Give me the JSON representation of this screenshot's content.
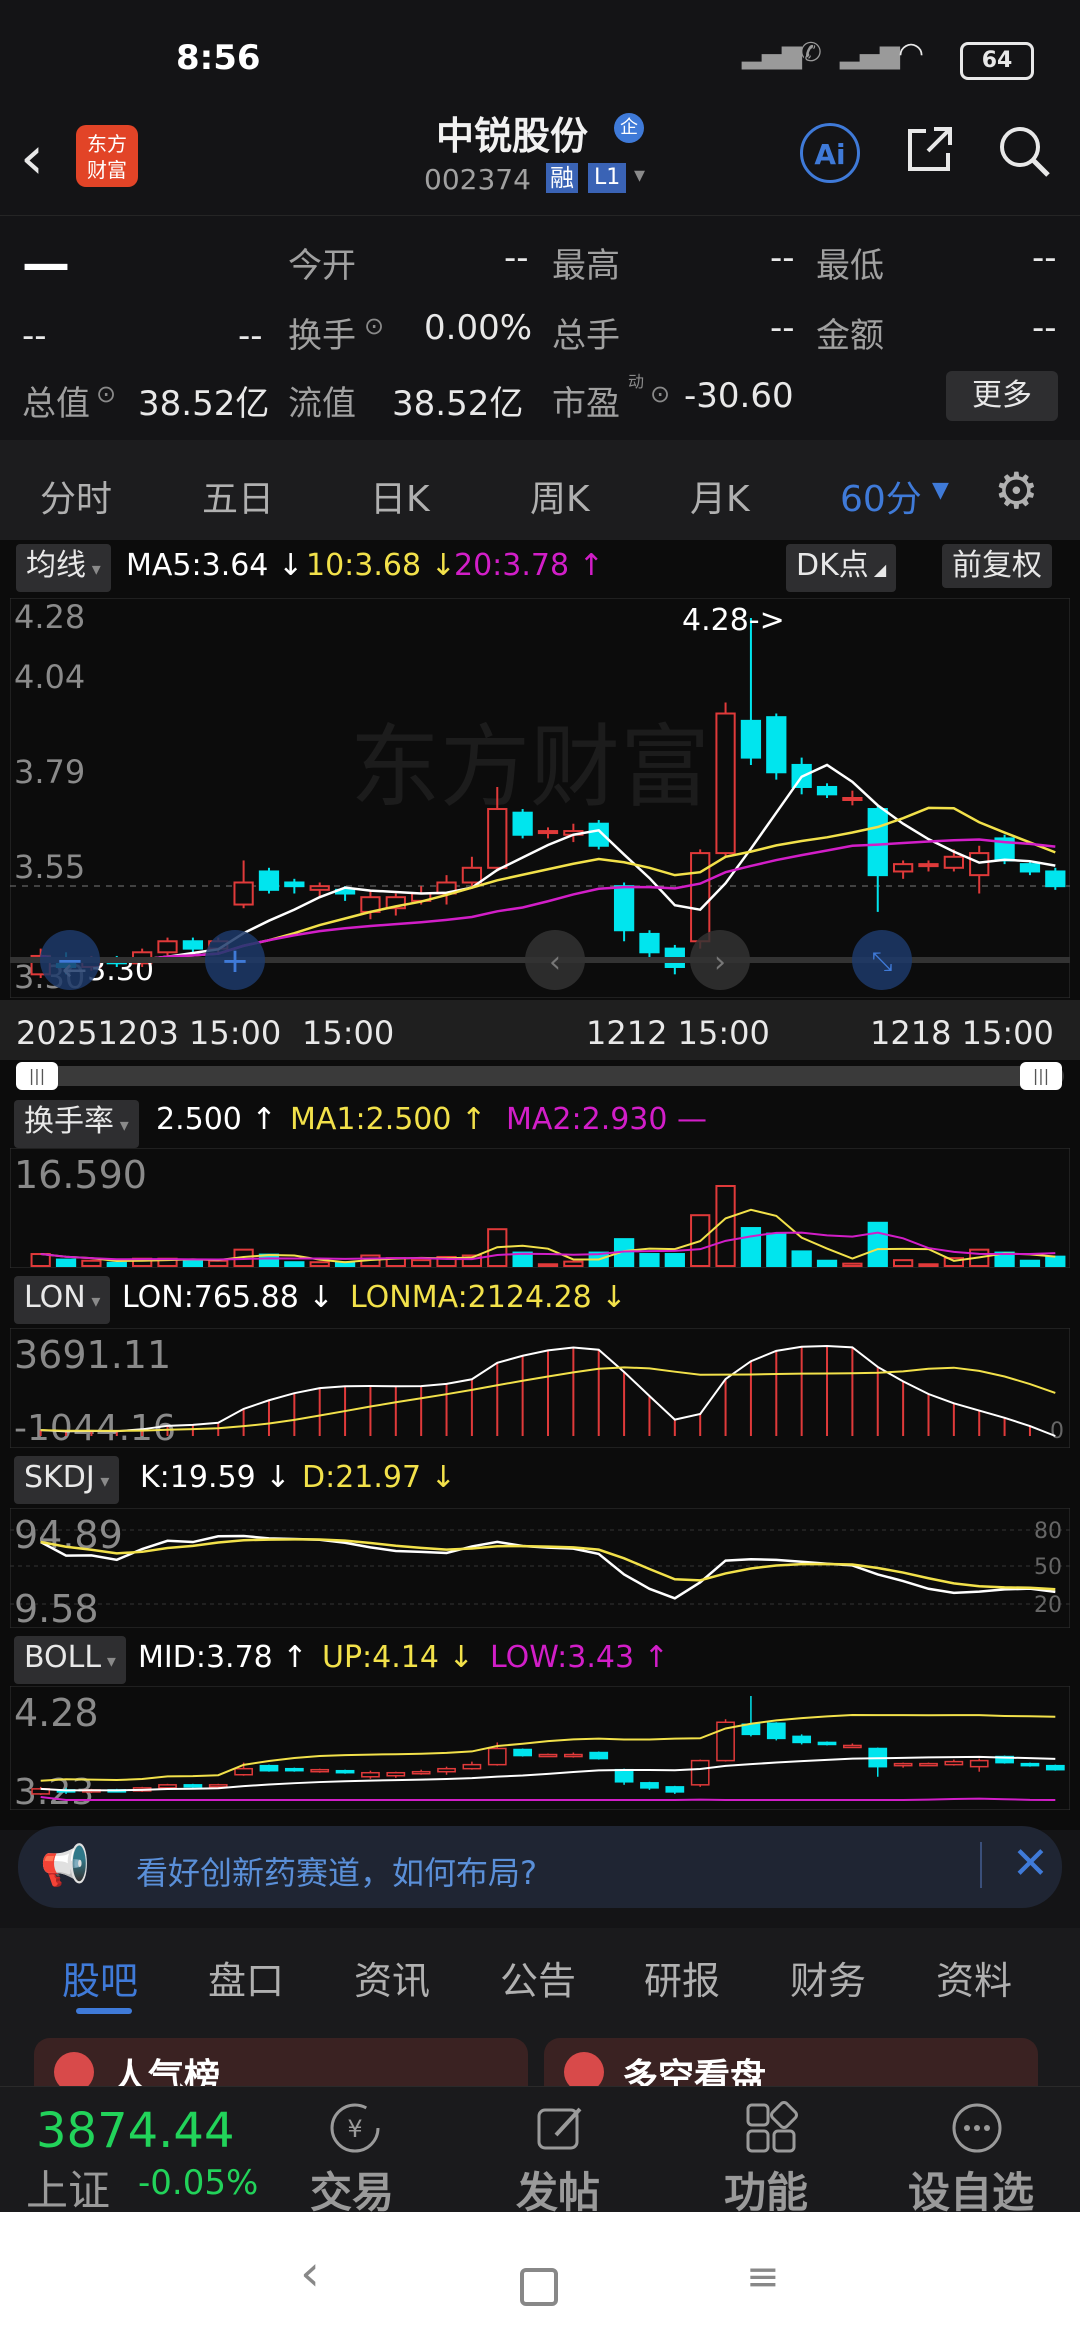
{
  "status_bar": {
    "time": "8:56",
    "battery": "64"
  },
  "header": {
    "stock_name": "中锐股份",
    "qi_badge": "企",
    "code": "002374",
    "rong": "融",
    "level": "L1",
    "ai_label": "Ai"
  },
  "quote": {
    "price": "—",
    "change": "--",
    "change_pct": "--",
    "jinkai_label": "今开",
    "jinkai": "--",
    "zuigao_label": "最高",
    "zuigao": "--",
    "zuidi_label": "最低",
    "zuidi": "--",
    "huanshou_label": "换手",
    "huanshou": "0.00%",
    "zongshou_label": "总手",
    "zongshou": "--",
    "jine_label": "金额",
    "jine": "--",
    "zongzhi_label": "总值",
    "zongzhi": "38.52亿",
    "liuzhi_label": "流值",
    "liuzhi": "38.52亿",
    "shiying_label": "市盈",
    "shiying_sup": "动",
    "shiying": "-30.60",
    "more": "更多"
  },
  "tabs": [
    "分时",
    "五日",
    "日K",
    "周K",
    "月K",
    "60分"
  ],
  "main_chart": {
    "indicator": "均线",
    "ma5": "MA5:3.64",
    "ma10": "10:3.68",
    "ma20": "20:3.78",
    "dk_label": "DK点",
    "fq_label": "前复权",
    "y_labels": [
      "4.28",
      "4.04",
      "3.79",
      "3.55",
      "3.30"
    ],
    "high_mark": "4.28->",
    "low_mark": "3.30",
    "x_labels": [
      "20251203 15:00",
      "15:00",
      "1212 15:00",
      "1218 15:00"
    ],
    "watermark": "东方财富"
  },
  "chart_data": {
    "type": "candlestick",
    "ylim": [
      3.3,
      4.28
    ],
    "candles": [
      {
        "o": 3.31,
        "c": 3.36,
        "h": 3.38,
        "l": 3.3
      },
      {
        "o": 3.35,
        "c": 3.33,
        "h": 3.37,
        "l": 3.31
      },
      {
        "o": 3.33,
        "c": 3.35,
        "h": 3.36,
        "l": 3.32
      },
      {
        "o": 3.35,
        "c": 3.34,
        "h": 3.36,
        "l": 3.33
      },
      {
        "o": 3.34,
        "c": 3.37,
        "h": 3.38,
        "l": 3.33
      },
      {
        "o": 3.37,
        "c": 3.4,
        "h": 3.41,
        "l": 3.36
      },
      {
        "o": 3.4,
        "c": 3.38,
        "h": 3.41,
        "l": 3.37
      },
      {
        "o": 3.38,
        "c": 3.4,
        "h": 3.41,
        "l": 3.37
      },
      {
        "o": 3.5,
        "c": 3.56,
        "h": 3.62,
        "l": 3.49
      },
      {
        "o": 3.59,
        "c": 3.54,
        "h": 3.6,
        "l": 3.53
      },
      {
        "o": 3.56,
        "c": 3.55,
        "h": 3.57,
        "l": 3.53
      },
      {
        "o": 3.54,
        "c": 3.55,
        "h": 3.56,
        "l": 3.52
      },
      {
        "o": 3.54,
        "c": 3.53,
        "h": 3.55,
        "l": 3.51
      },
      {
        "o": 3.48,
        "c": 3.52,
        "h": 3.54,
        "l": 3.46
      },
      {
        "o": 3.49,
        "c": 3.52,
        "h": 3.53,
        "l": 3.47
      },
      {
        "o": 3.51,
        "c": 3.53,
        "h": 3.55,
        "l": 3.5
      },
      {
        "o": 3.53,
        "c": 3.56,
        "h": 3.58,
        "l": 3.5
      },
      {
        "o": 3.56,
        "c": 3.6,
        "h": 3.63,
        "l": 3.55
      },
      {
        "o": 3.6,
        "c": 3.76,
        "h": 3.82,
        "l": 3.59
      },
      {
        "o": 3.75,
        "c": 3.69,
        "h": 3.76,
        "l": 3.68
      },
      {
        "o": 3.7,
        "c": 3.7,
        "h": 3.71,
        "l": 3.68
      },
      {
        "o": 3.69,
        "c": 3.7,
        "h": 3.72,
        "l": 3.67
      },
      {
        "o": 3.72,
        "c": 3.66,
        "h": 3.73,
        "l": 3.65
      },
      {
        "o": 3.55,
        "c": 3.43,
        "h": 3.56,
        "l": 3.4
      },
      {
        "o": 3.42,
        "c": 3.37,
        "h": 3.43,
        "l": 3.35
      },
      {
        "o": 3.38,
        "c": 3.33,
        "h": 3.39,
        "l": 3.31
      },
      {
        "o": 3.4,
        "c": 3.64,
        "h": 3.65,
        "l": 3.38
      },
      {
        "o": 3.64,
        "c": 4.02,
        "h": 4.05,
        "l": 3.63
      },
      {
        "o": 4.0,
        "c": 3.9,
        "h": 4.28,
        "l": 3.88
      },
      {
        "o": 4.01,
        "c": 3.86,
        "h": 4.02,
        "l": 3.84
      },
      {
        "o": 3.88,
        "c": 3.82,
        "h": 3.9,
        "l": 3.8
      },
      {
        "o": 3.82,
        "c": 3.8,
        "h": 3.83,
        "l": 3.79
      },
      {
        "o": 3.79,
        "c": 3.79,
        "h": 3.81,
        "l": 3.77
      },
      {
        "o": 3.76,
        "c": 3.58,
        "h": 3.77,
        "l": 3.48
      },
      {
        "o": 3.59,
        "c": 3.61,
        "h": 3.62,
        "l": 3.57
      },
      {
        "o": 3.61,
        "c": 3.61,
        "h": 3.62,
        "l": 3.59
      },
      {
        "o": 3.6,
        "c": 3.63,
        "h": 3.65,
        "l": 3.59
      },
      {
        "o": 3.58,
        "c": 3.64,
        "h": 3.66,
        "l": 3.53
      },
      {
        "o": 3.68,
        "c": 3.62,
        "h": 3.69,
        "l": 3.61
      },
      {
        "o": 3.61,
        "c": 3.59,
        "h": 3.62,
        "l": 3.58
      },
      {
        "o": 3.59,
        "c": 3.55,
        "h": 3.6,
        "l": 3.54
      }
    ]
  },
  "subcharts": {
    "turnover": {
      "name": "换手率",
      "val": "2.500",
      "ma1": "MA1:2.500",
      "ma2": "MA2:2.930",
      "max": "16.590"
    },
    "lon": {
      "name": "LON",
      "val": "LON:765.88",
      "lonma": "LONMA:2124.28",
      "top": "3691.11",
      "bottom": "-1044.16",
      "zero": "0"
    },
    "skdj": {
      "name": "SKDJ",
      "k": "K:19.59",
      "d": "D:21.97",
      "top": "94.89",
      "bottom": "9.58",
      "g80": "80",
      "g50": "50",
      "g20": "20"
    },
    "boll": {
      "name": "BOLL",
      "mid": "MID:3.78",
      "up": "UP:4.14",
      "low": "LOW:3.43",
      "top": "4.28",
      "bottom": "3.23"
    }
  },
  "notice": {
    "text": "看好创新药赛道，如何布局?"
  },
  "news_tabs": [
    "股吧",
    "盘口",
    "资讯",
    "公告",
    "研报",
    "财务",
    "资料"
  ],
  "cards": [
    "人气榜",
    "多空看盘"
  ],
  "bottom_bar": {
    "index_value": "3874.44",
    "index_name": "上证",
    "index_change": "-0.05%",
    "items": [
      "交易",
      "发帖",
      "功能",
      "设自选"
    ]
  },
  "colors": {
    "up": "#e03a3a",
    "down": "#00e5ee",
    "accent": "#3f7ad8",
    "ma5": "#ffffff",
    "ma10": "#f2e14a",
    "ma20": "#d21ec8"
  }
}
